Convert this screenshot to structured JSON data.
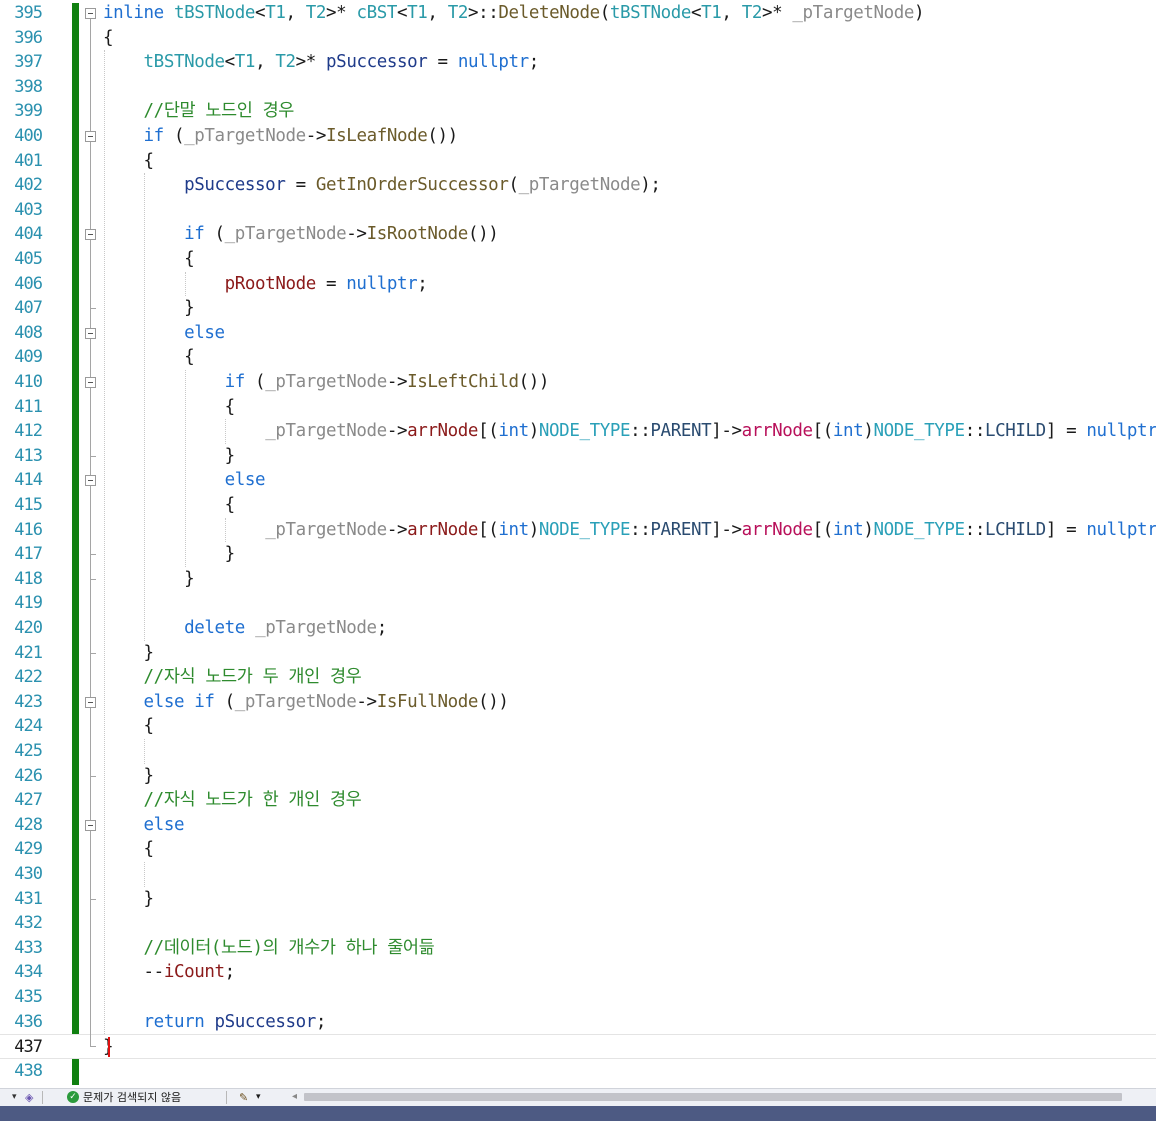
{
  "editor": {
    "current_line": "437",
    "lines": [
      {
        "n": "395",
        "tokens": [
          {
            "t": "inline ",
            "c": "kw"
          },
          {
            "t": "tBSTNode",
            "c": "ty"
          },
          {
            "t": "<",
            "c": ""
          },
          {
            "t": "T1",
            "c": "ty"
          },
          {
            "t": ", ",
            "c": ""
          },
          {
            "t": "T2",
            "c": "ty"
          },
          {
            "t": ">* ",
            "c": ""
          },
          {
            "t": "cBST",
            "c": "ty"
          },
          {
            "t": "<",
            "c": ""
          },
          {
            "t": "T1",
            "c": "ty"
          },
          {
            "t": ", ",
            "c": ""
          },
          {
            "t": "T2",
            "c": "ty"
          },
          {
            "t": ">::",
            "c": ""
          },
          {
            "t": "DeleteNode",
            "c": "fn"
          },
          {
            "t": "(",
            "c": ""
          },
          {
            "t": "tBSTNode",
            "c": "ty"
          },
          {
            "t": "<",
            "c": ""
          },
          {
            "t": "T1",
            "c": "ty"
          },
          {
            "t": ", ",
            "c": ""
          },
          {
            "t": "T2",
            "c": "ty"
          },
          {
            "t": ">* ",
            "c": ""
          },
          {
            "t": "_pTargetNode",
            "c": "par"
          },
          {
            "t": ")",
            "c": ""
          }
        ]
      },
      {
        "n": "396",
        "tokens": [
          {
            "t": "{",
            "c": ""
          }
        ]
      },
      {
        "n": "397",
        "tokens": [
          {
            "t": "    ",
            "c": ""
          },
          {
            "t": "tBSTNode",
            "c": "ty"
          },
          {
            "t": "<",
            "c": ""
          },
          {
            "t": "T1",
            "c": "ty"
          },
          {
            "t": ", ",
            "c": ""
          },
          {
            "t": "T2",
            "c": "ty"
          },
          {
            "t": ">* ",
            "c": ""
          },
          {
            "t": "pSuccessor",
            "c": "loc"
          },
          {
            "t": " = ",
            "c": ""
          },
          {
            "t": "nullptr",
            "c": "kw"
          },
          {
            "t": ";",
            "c": ""
          }
        ]
      },
      {
        "n": "398",
        "tokens": []
      },
      {
        "n": "399",
        "tokens": [
          {
            "t": "    ",
            "c": ""
          },
          {
            "t": "//단말 노드인 경우",
            "c": "cm"
          }
        ]
      },
      {
        "n": "400",
        "tokens": [
          {
            "t": "    ",
            "c": ""
          },
          {
            "t": "if",
            "c": "kw"
          },
          {
            "t": " (",
            "c": ""
          },
          {
            "t": "_pTargetNode",
            "c": "par"
          },
          {
            "t": "->",
            "c": ""
          },
          {
            "t": "IsLeafNode",
            "c": "fn"
          },
          {
            "t": "())",
            "c": ""
          }
        ]
      },
      {
        "n": "401",
        "tokens": [
          {
            "t": "    {",
            "c": ""
          }
        ]
      },
      {
        "n": "402",
        "tokens": [
          {
            "t": "        ",
            "c": ""
          },
          {
            "t": "pSuccessor",
            "c": "loc"
          },
          {
            "t": " = ",
            "c": ""
          },
          {
            "t": "GetInOrderSuccessor",
            "c": "fn"
          },
          {
            "t": "(",
            "c": ""
          },
          {
            "t": "_pTargetNode",
            "c": "par"
          },
          {
            "t": ");",
            "c": ""
          }
        ]
      },
      {
        "n": "403",
        "tokens": []
      },
      {
        "n": "404",
        "tokens": [
          {
            "t": "        ",
            "c": ""
          },
          {
            "t": "if",
            "c": "kw"
          },
          {
            "t": " (",
            "c": ""
          },
          {
            "t": "_pTargetNode",
            "c": "par"
          },
          {
            "t": "->",
            "c": ""
          },
          {
            "t": "IsRootNode",
            "c": "fn"
          },
          {
            "t": "())",
            "c": ""
          }
        ]
      },
      {
        "n": "405",
        "tokens": [
          {
            "t": "        {",
            "c": ""
          }
        ]
      },
      {
        "n": "406",
        "tokens": [
          {
            "t": "            ",
            "c": ""
          },
          {
            "t": "pRootNode",
            "c": "mem"
          },
          {
            "t": " = ",
            "c": ""
          },
          {
            "t": "nullptr",
            "c": "kw"
          },
          {
            "t": ";",
            "c": ""
          }
        ]
      },
      {
        "n": "407",
        "tokens": [
          {
            "t": "        }",
            "c": ""
          }
        ]
      },
      {
        "n": "408",
        "tokens": [
          {
            "t": "        ",
            "c": ""
          },
          {
            "t": "else",
            "c": "kw"
          }
        ]
      },
      {
        "n": "409",
        "tokens": [
          {
            "t": "        {",
            "c": ""
          }
        ]
      },
      {
        "n": "410",
        "tokens": [
          {
            "t": "            ",
            "c": ""
          },
          {
            "t": "if",
            "c": "kw"
          },
          {
            "t": " (",
            "c": ""
          },
          {
            "t": "_pTargetNode",
            "c": "par"
          },
          {
            "t": "->",
            "c": ""
          },
          {
            "t": "IsLeftChild",
            "c": "fn"
          },
          {
            "t": "())",
            "c": ""
          }
        ]
      },
      {
        "n": "411",
        "tokens": [
          {
            "t": "            {",
            "c": ""
          }
        ]
      },
      {
        "n": "412",
        "tokens": [
          {
            "t": "                ",
            "c": ""
          },
          {
            "t": "_pTargetNode",
            "c": "par"
          },
          {
            "t": "->",
            "c": ""
          },
          {
            "t": "arrNode",
            "c": "mem"
          },
          {
            "t": "[(",
            "c": ""
          },
          {
            "t": "int",
            "c": "kw"
          },
          {
            "t": ")",
            "c": ""
          },
          {
            "t": "NODE_TYPE",
            "c": "en"
          },
          {
            "t": "::",
            "c": ""
          },
          {
            "t": "PARENT",
            "c": "emem"
          },
          {
            "t": "]->",
            "c": ""
          },
          {
            "t": "arrNode",
            "c": "mf"
          },
          {
            "t": "[(",
            "c": ""
          },
          {
            "t": "int",
            "c": "kw"
          },
          {
            "t": ")",
            "c": ""
          },
          {
            "t": "NODE_TYPE",
            "c": "en"
          },
          {
            "t": "::",
            "c": ""
          },
          {
            "t": "LCHILD",
            "c": "emem"
          },
          {
            "t": "] = ",
            "c": ""
          },
          {
            "t": "nullptr",
            "c": "kw"
          },
          {
            "t": ";",
            "c": ""
          }
        ]
      },
      {
        "n": "413",
        "tokens": [
          {
            "t": "            }",
            "c": ""
          }
        ]
      },
      {
        "n": "414",
        "tokens": [
          {
            "t": "            ",
            "c": ""
          },
          {
            "t": "else",
            "c": "kw"
          }
        ]
      },
      {
        "n": "415",
        "tokens": [
          {
            "t": "            {",
            "c": ""
          }
        ]
      },
      {
        "n": "416",
        "tokens": [
          {
            "t": "                ",
            "c": ""
          },
          {
            "t": "_pTargetNode",
            "c": "par"
          },
          {
            "t": "->",
            "c": ""
          },
          {
            "t": "arrNode",
            "c": "mem"
          },
          {
            "t": "[(",
            "c": ""
          },
          {
            "t": "int",
            "c": "kw"
          },
          {
            "t": ")",
            "c": ""
          },
          {
            "t": "NODE_TYPE",
            "c": "en"
          },
          {
            "t": "::",
            "c": ""
          },
          {
            "t": "PARENT",
            "c": "emem"
          },
          {
            "t": "]->",
            "c": ""
          },
          {
            "t": "arrNode",
            "c": "mf"
          },
          {
            "t": "[(",
            "c": ""
          },
          {
            "t": "int",
            "c": "kw"
          },
          {
            "t": ")",
            "c": ""
          },
          {
            "t": "NODE_TYPE",
            "c": "en"
          },
          {
            "t": "::",
            "c": ""
          },
          {
            "t": "LCHILD",
            "c": "emem"
          },
          {
            "t": "] = ",
            "c": ""
          },
          {
            "t": "nullptr",
            "c": "kw"
          },
          {
            "t": ";",
            "c": ""
          }
        ]
      },
      {
        "n": "417",
        "tokens": [
          {
            "t": "            }",
            "c": ""
          }
        ]
      },
      {
        "n": "418",
        "tokens": [
          {
            "t": "        }",
            "c": ""
          }
        ]
      },
      {
        "n": "419",
        "tokens": []
      },
      {
        "n": "420",
        "tokens": [
          {
            "t": "        ",
            "c": ""
          },
          {
            "t": "delete",
            "c": "kw"
          },
          {
            "t": " ",
            "c": ""
          },
          {
            "t": "_pTargetNode",
            "c": "par"
          },
          {
            "t": ";",
            "c": ""
          }
        ]
      },
      {
        "n": "421",
        "tokens": [
          {
            "t": "    }",
            "c": ""
          }
        ]
      },
      {
        "n": "422",
        "tokens": [
          {
            "t": "    ",
            "c": ""
          },
          {
            "t": "//자식 노드가 두 개인 경우",
            "c": "cm"
          }
        ]
      },
      {
        "n": "423",
        "tokens": [
          {
            "t": "    ",
            "c": ""
          },
          {
            "t": "else if",
            "c": "kw"
          },
          {
            "t": " (",
            "c": ""
          },
          {
            "t": "_pTargetNode",
            "c": "par"
          },
          {
            "t": "->",
            "c": ""
          },
          {
            "t": "IsFullNode",
            "c": "fn"
          },
          {
            "t": "())",
            "c": ""
          }
        ]
      },
      {
        "n": "424",
        "tokens": [
          {
            "t": "    {",
            "c": ""
          }
        ]
      },
      {
        "n": "425",
        "tokens": []
      },
      {
        "n": "426",
        "tokens": [
          {
            "t": "    }",
            "c": ""
          }
        ]
      },
      {
        "n": "427",
        "tokens": [
          {
            "t": "    ",
            "c": ""
          },
          {
            "t": "//자식 노드가 한 개인 경우",
            "c": "cm"
          }
        ]
      },
      {
        "n": "428",
        "tokens": [
          {
            "t": "    ",
            "c": ""
          },
          {
            "t": "else",
            "c": "kw"
          }
        ]
      },
      {
        "n": "429",
        "tokens": [
          {
            "t": "    {",
            "c": ""
          }
        ]
      },
      {
        "n": "430",
        "tokens": []
      },
      {
        "n": "431",
        "tokens": [
          {
            "t": "    }",
            "c": ""
          }
        ]
      },
      {
        "n": "432",
        "tokens": []
      },
      {
        "n": "433",
        "tokens": [
          {
            "t": "    ",
            "c": ""
          },
          {
            "t": "//데이터(노드)의 개수가 하나 줄어듦",
            "c": "cm"
          }
        ]
      },
      {
        "n": "434",
        "tokens": [
          {
            "t": "    --",
            "c": ""
          },
          {
            "t": "iCount",
            "c": "mem"
          },
          {
            "t": ";",
            "c": ""
          }
        ]
      },
      {
        "n": "435",
        "tokens": []
      },
      {
        "n": "436",
        "tokens": [
          {
            "t": "    ",
            "c": ""
          },
          {
            "t": "return",
            "c": "kw"
          },
          {
            "t": " ",
            "c": ""
          },
          {
            "t": "pSuccessor",
            "c": "loc"
          },
          {
            "t": ";",
            "c": ""
          }
        ]
      },
      {
        "n": "437",
        "tokens": [
          {
            "t": "}",
            "c": ""
          }
        ]
      },
      {
        "n": "438",
        "tokens": []
      }
    ]
  },
  "statusbar": {
    "issues_text": "문제가 검색되지 않음",
    "issues_icon": "check-circle-icon",
    "cleanup_icon": "brush-icon"
  },
  "colors": {
    "keyword": "#1f6fd0",
    "type": "#2a9aa8",
    "comment": "#2e8b2e",
    "change_bar": "#108010",
    "caret": "#e01010"
  }
}
